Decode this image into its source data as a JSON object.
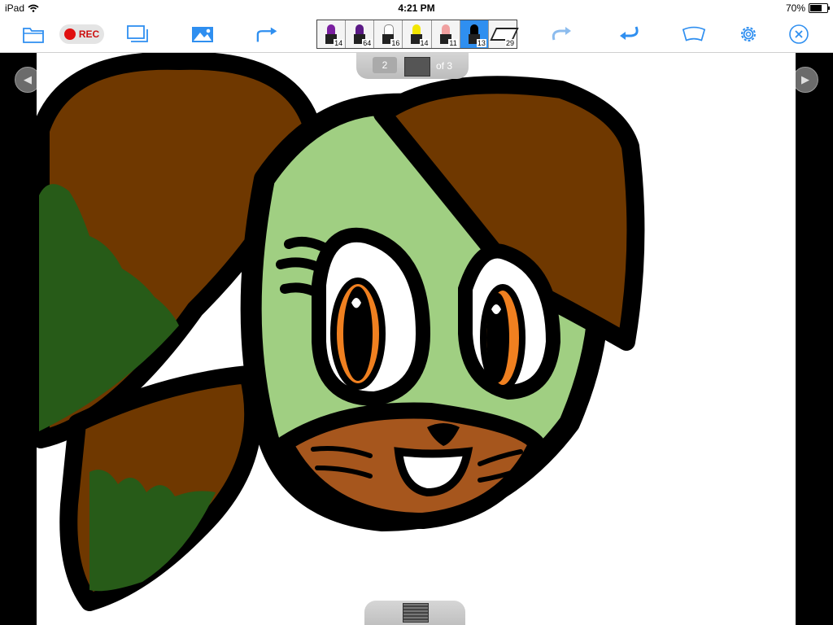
{
  "status_bar": {
    "device": "iPad",
    "time": "4:21 PM",
    "battery_percent": "70%",
    "battery_level": 0.7
  },
  "toolbar": {
    "rec_label": "REC",
    "icons": [
      "folder-icon",
      "layers-icon",
      "image-icon",
      "share-icon",
      "redo-icon",
      "undo-icon",
      "ruler-icon",
      "gear-icon",
      "close-icon"
    ],
    "pens": [
      {
        "color": "#7a1fa0",
        "size": "14"
      },
      {
        "color": "#5b1a86",
        "size": "64"
      },
      {
        "color": "#ffffff",
        "size": "16"
      },
      {
        "color": "#f2e600",
        "size": "14"
      },
      {
        "color": "#f0a0a0",
        "size": "11"
      },
      {
        "color": "#000000",
        "size": "13",
        "selected": true
      },
      {
        "color": "eraser",
        "size": "29"
      }
    ],
    "accent_color": "#2f8ff0"
  },
  "pager": {
    "current": "2",
    "total": "of 3"
  },
  "drawing": {
    "description_colors": {
      "fur_brown": "#6f3800",
      "face_green": "#a0cf82",
      "hair_green": "#275b18",
      "muzzle_orange": "#a6561d",
      "eye_orange": "#f08020"
    }
  }
}
